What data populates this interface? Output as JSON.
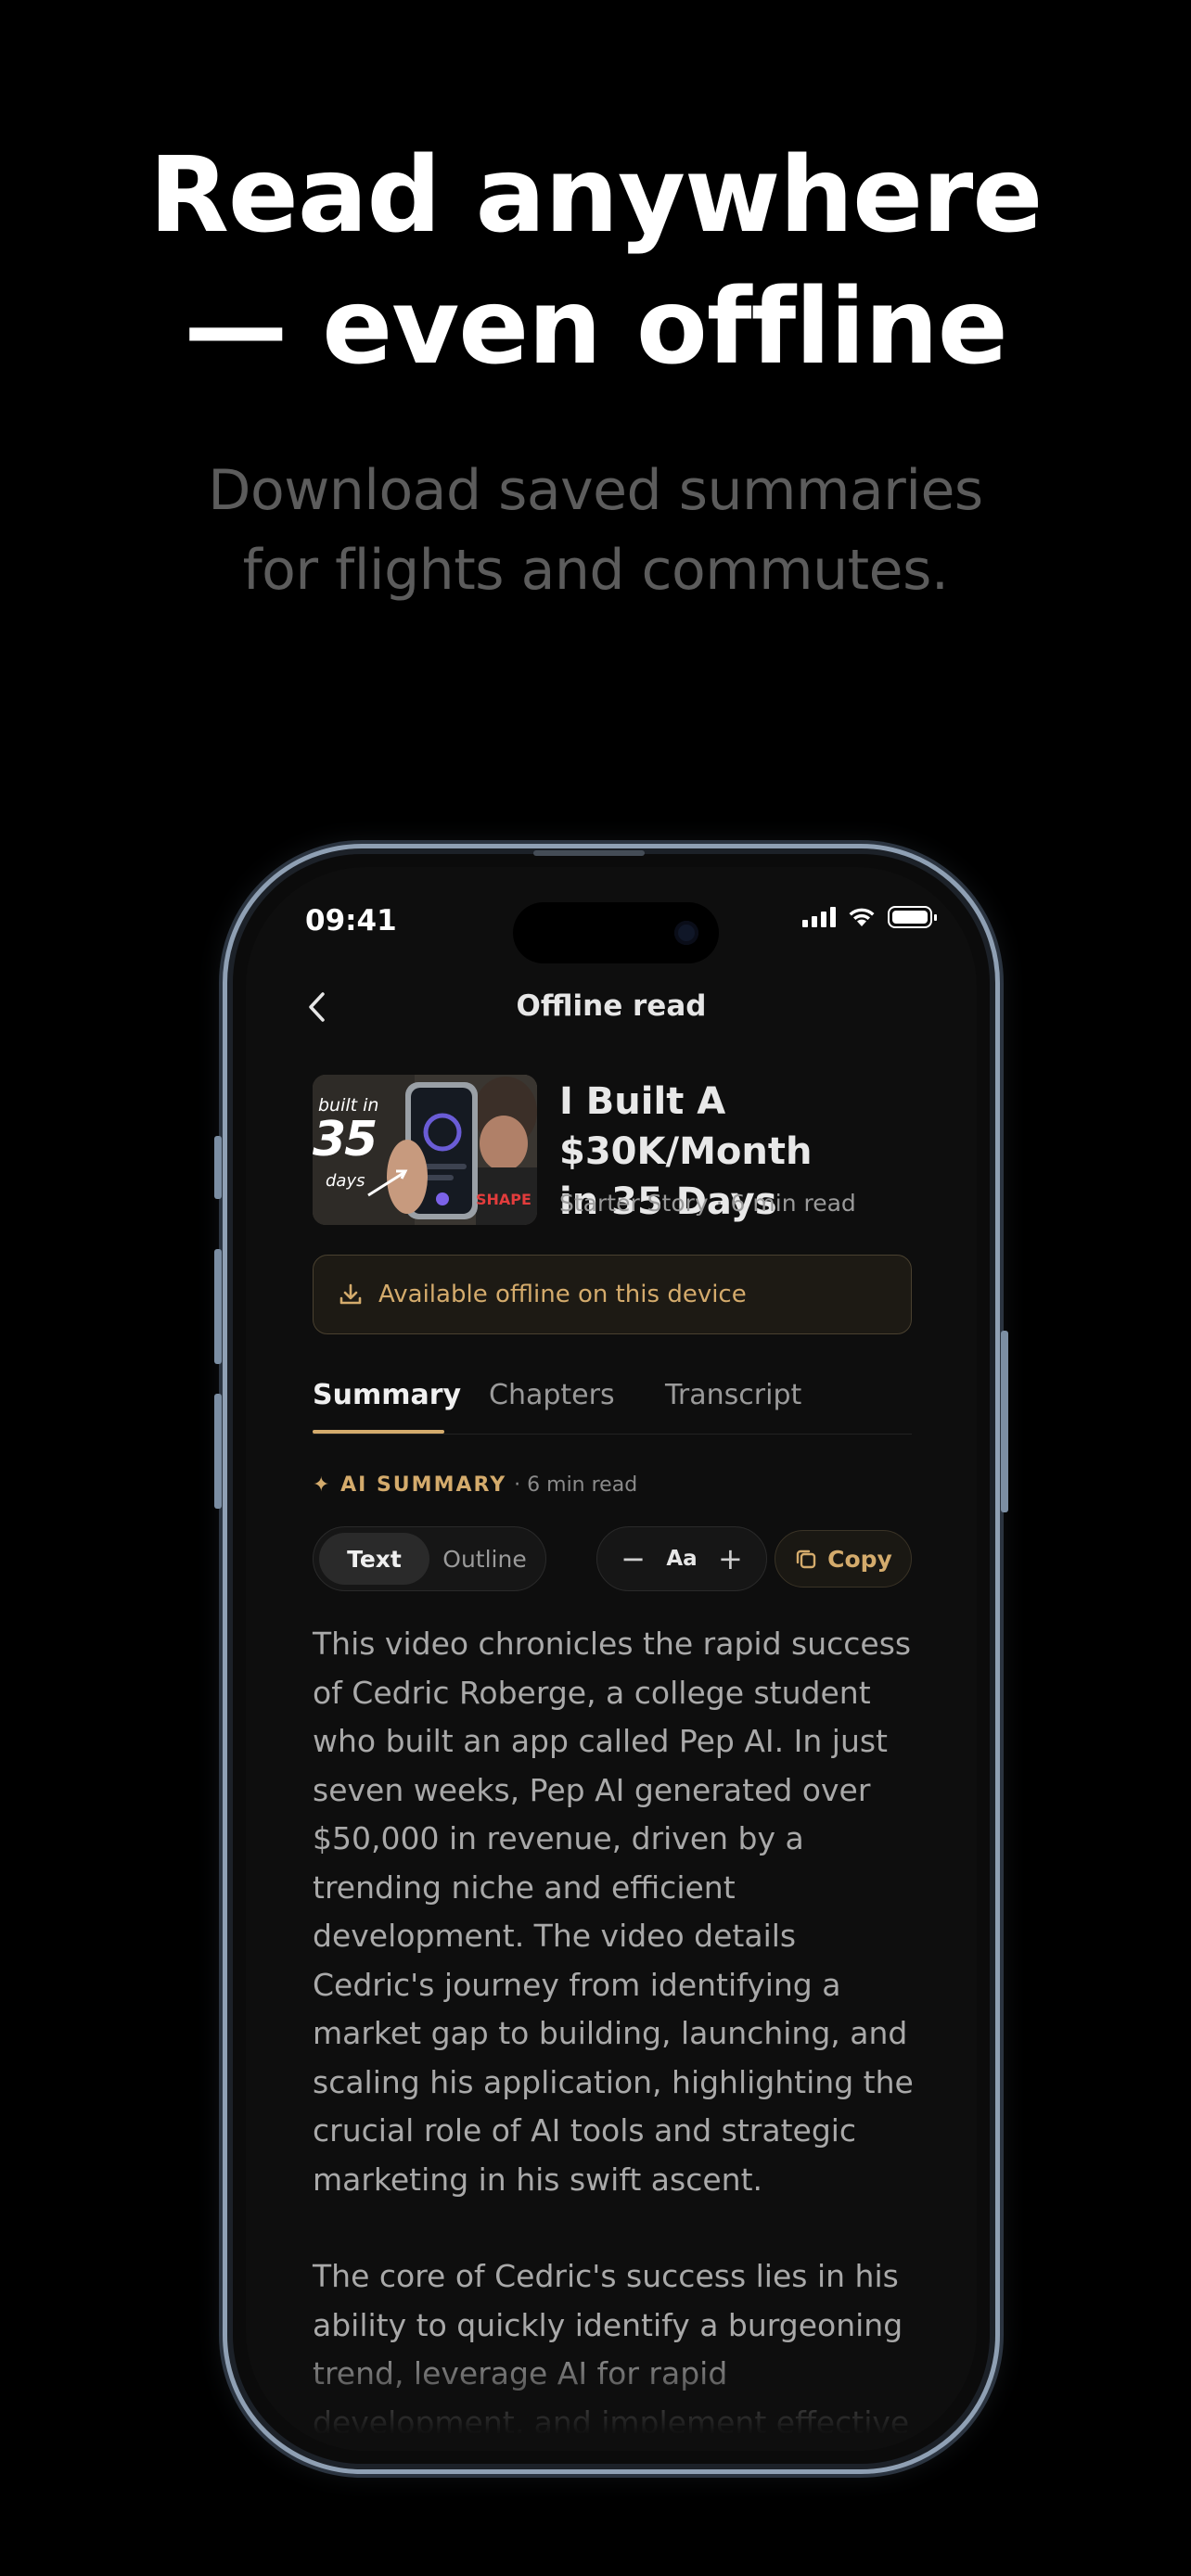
{
  "hero": {
    "headline_line1": "Read anywhere",
    "headline_line2": "— even offline",
    "sub_line1": "Download saved summaries",
    "sub_line2": "for flights and commutes."
  },
  "status_bar": {
    "time": "09:41",
    "icons": [
      "signal-icon",
      "wifi-icon",
      "battery-icon"
    ]
  },
  "nav": {
    "title": "Offline read",
    "back_icon": "chevron-left-icon"
  },
  "video": {
    "title_line1": "I Built A $30K/Month",
    "title_line2": "in 35 Days",
    "meta": "Starter Story · 6 min read",
    "thumbnail_text": {
      "top": "built in",
      "number": "35",
      "bottom": "days"
    }
  },
  "offline_banner": {
    "text": "Available offline on this device",
    "icon": "download-icon",
    "accent": "#d4ab6c"
  },
  "tabs": [
    {
      "label": "Summary",
      "active": true
    },
    {
      "label": "Chapters",
      "active": false
    },
    {
      "label": "Transcript",
      "active": false
    }
  ],
  "ai_summary": {
    "badge": "✦ AI SUMMARY",
    "meta": "· 6 min read"
  },
  "controls": {
    "view_modes": [
      {
        "label": "Text",
        "active": true
      },
      {
        "label": "Outline",
        "active": false
      }
    ],
    "font_minus": "−",
    "font_label": "Aa",
    "font_plus": "+",
    "copy_label": "Copy"
  },
  "summary": {
    "paragraph1": "This video chronicles the rapid success of Cedric Roberge, a college student who built an app called Pep AI. In just seven weeks, Pep AI generated over $50,000 in revenue, driven by a trending niche and efficient development. The video details Cedric's journey from identifying a market gap to building, launching, and scaling his application, highlighting the crucial role of AI tools and strategic marketing in his swift ascent.",
    "paragraph2": "The core of Cedric's success lies in his ability to quickly identify a burgeoning trend, leverage AI for rapid development, and implement effective marketing strategies. He emphasizes that building a successful app is not just about the"
  }
}
